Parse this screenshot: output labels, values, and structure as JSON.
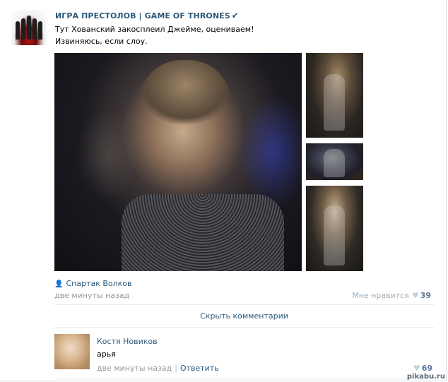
{
  "post": {
    "group_name": "ИГРА ПРЕСТОЛОВ | GAME OF THRONES",
    "verified_icon": "checkmark-icon",
    "text_line1": "Тут Хованский закосплеил Джейме, оцениваем!",
    "text_line2": "Извиняюсь, если слоу.",
    "author": "Спартак Волков",
    "time": "две минуты назад",
    "like_label": "Мне нравится",
    "like_count": "39"
  },
  "comments": {
    "hide_label": "Скрыть комментарии",
    "items": [
      {
        "author": "Костя Новиков",
        "text": "арья",
        "time": "две минуты назад",
        "reply_label": "Ответить",
        "like_count": "69"
      }
    ]
  },
  "watermark": "pikabu.ru",
  "colors": {
    "link": "#2b587a",
    "muted": "#999999",
    "like_count": "#5d7a96"
  }
}
